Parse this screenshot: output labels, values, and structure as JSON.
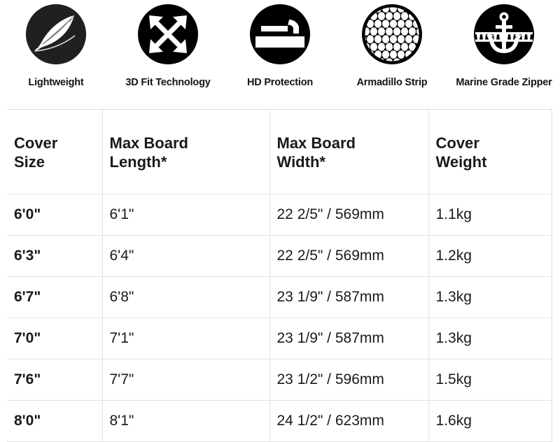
{
  "features": [
    {
      "label": "Lightweight",
      "icon": "feather-icon"
    },
    {
      "label": "3D Fit Technology",
      "icon": "four-way-arrows-icon"
    },
    {
      "label": "HD Protection",
      "icon": "hammer-icon"
    },
    {
      "label": "Armadillo Strip",
      "icon": "honeycomb-scales-icon"
    },
    {
      "label": "Marine Grade Zipper",
      "icon": "anchor-zipper-icon"
    }
  ],
  "table": {
    "headers": [
      {
        "line1": "Cover",
        "line2": "Size"
      },
      {
        "line1": "Max Board",
        "line2": "Length*"
      },
      {
        "line1": "Max Board",
        "line2": "Width*"
      },
      {
        "line1": "Cover",
        "line2": "Weight"
      }
    ],
    "rows": [
      {
        "cover_size": "6'0\"",
        "max_board_length": "6'1\"",
        "max_board_width": "22 2/5\" / 569mm",
        "cover_weight": "1.1kg"
      },
      {
        "cover_size": "6'3\"",
        "max_board_length": "6'4\"",
        "max_board_width": "22 2/5\" / 569mm",
        "cover_weight": "1.2kg"
      },
      {
        "cover_size": "6'7\"",
        "max_board_length": "6'8\"",
        "max_board_width": "23 1/9\" / 587mm",
        "cover_weight": "1.3kg"
      },
      {
        "cover_size": "7'0\"",
        "max_board_length": "7'1\"",
        "max_board_width": "23 1/9\" / 587mm",
        "cover_weight": "1.3kg"
      },
      {
        "cover_size": "7'6\"",
        "max_board_length": "7'7\"",
        "max_board_width": "23 1/2\" / 596mm",
        "cover_weight": "1.5kg"
      },
      {
        "cover_size": "8'0\"",
        "max_board_length": "8'1\"",
        "max_board_width": "24 1/2\" / 623mm",
        "cover_weight": "1.6kg"
      }
    ]
  },
  "colors": {
    "badge_black": "#000000",
    "badge_charcoal": "#221f1f",
    "text": "#1a1a1a",
    "grid_line": "#e3e3e3",
    "background": "#ffffff"
  }
}
